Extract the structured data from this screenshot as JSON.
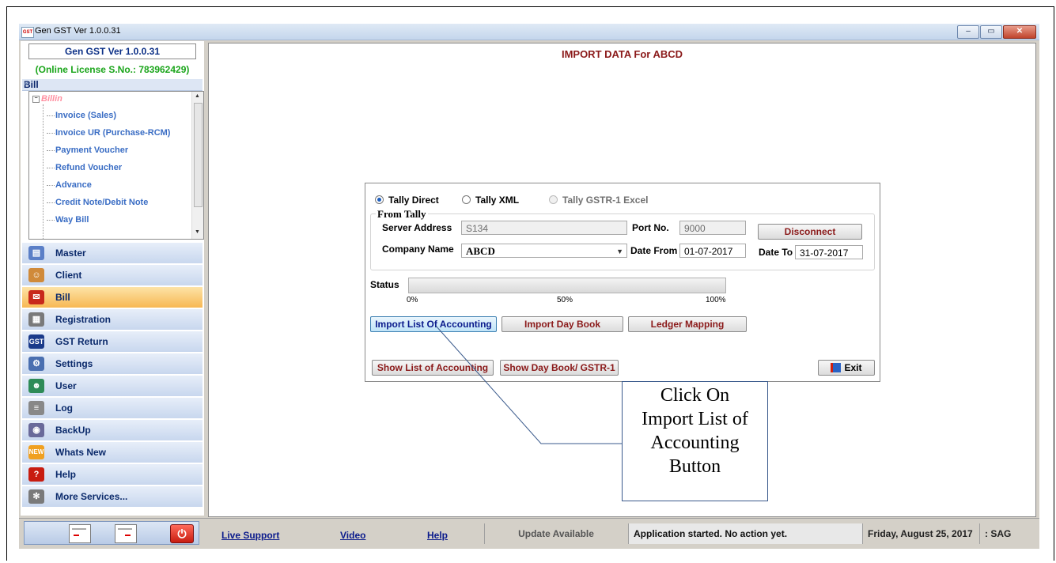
{
  "window": {
    "title": "Gen GST  Ver 1.0.0.31",
    "app_icon_text": "GST",
    "minimize": "–",
    "restore": "▭",
    "close": "✕"
  },
  "sidebar": {
    "brand": "Gen GST  Ver 1.0.0.31",
    "license": "(Online License S.No.: 783962429)",
    "section_title": "Bill",
    "collapse_icon": "«",
    "tree": {
      "root": "Billin",
      "items": [
        "Invoice (Sales)",
        "Invoice UR (Purchase-RCM)",
        "Payment Voucher",
        "Refund Voucher",
        "Advance",
        "Credit Note/Debit Note",
        "Way Bill"
      ]
    },
    "menu": [
      {
        "label": "Master",
        "icon": "master-icon",
        "color": "#5b7fc7"
      },
      {
        "label": "Client",
        "icon": "client-icon",
        "color": "#d08a3a"
      },
      {
        "label": "Bill",
        "icon": "bill-icon",
        "color": "#c8281c",
        "active": true
      },
      {
        "label": "Registration",
        "icon": "registration-icon",
        "color": "#7a7a7a"
      },
      {
        "label": "GST Return",
        "icon": "gst-return-icon",
        "color": "#1a3a8a"
      },
      {
        "label": "Settings",
        "icon": "settings-icon",
        "color": "#4a6fb0"
      },
      {
        "label": "User",
        "icon": "user-icon",
        "color": "#2e8b57"
      },
      {
        "label": "Log",
        "icon": "log-icon",
        "color": "#888888"
      },
      {
        "label": "BackUp",
        "icon": "backup-icon",
        "color": "#6a6a9a"
      },
      {
        "label": "Whats New",
        "icon": "whats-new-icon",
        "color": "#f0a020"
      },
      {
        "label": "Help",
        "icon": "help-icon",
        "color": "#c81c10"
      },
      {
        "label": "More Services...",
        "icon": "more-services-icon",
        "color": "#7a7a7a"
      }
    ]
  },
  "main": {
    "title": "IMPORT DATA For ABCD",
    "radios": [
      {
        "label": "Tally Direct",
        "checked": true,
        "enabled": true
      },
      {
        "label": "Tally XML",
        "checked": false,
        "enabled": true
      },
      {
        "label": "Tally GSTR-1 Excel",
        "checked": false,
        "enabled": false
      }
    ],
    "group_title": "From Tally",
    "server_address_label": "Server Address",
    "server_address": "S134",
    "port_label": "Port No.",
    "port": "9000",
    "disconnect": "Disconnect",
    "company_label": "Company Name",
    "company": "ABCD",
    "date_from_label": "Date From",
    "date_from": "01-07-2017",
    "date_to_label": "Date To",
    "date_to": "31-07-2017",
    "status_label": "Status",
    "progress": 0,
    "progress_marks": [
      "0%",
      "50%",
      "100%"
    ],
    "buttons": {
      "import_list": "Import List Of Accounting",
      "import_daybook": "Import Day Book",
      "ledger_mapping": "Ledger Mapping",
      "show_list": "Show List of Accounting",
      "show_daybook": "Show Day Book/ GSTR-1",
      "exit": "Exit"
    }
  },
  "callout": {
    "lines": [
      "Click On",
      "Import List of",
      "Accounting",
      "Button"
    ]
  },
  "statusbar": {
    "live_support": "Live Support",
    "video": "Video",
    "help": "Help",
    "update": "Update Available",
    "message": "Application started. No action yet.",
    "date": "Friday, August 25, 2017",
    "user": ": SAG"
  }
}
